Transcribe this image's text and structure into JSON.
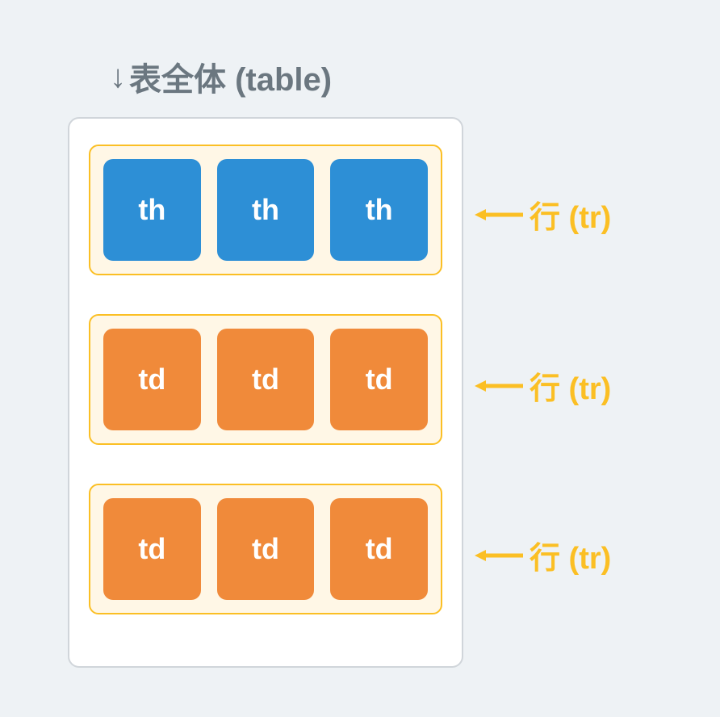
{
  "title": {
    "arrow": "↓",
    "text": "表全体 (table)"
  },
  "rows": [
    {
      "cells": [
        "th",
        "th",
        "th"
      ],
      "type": "header",
      "label": "行 (tr)"
    },
    {
      "cells": [
        "td",
        "td",
        "td"
      ],
      "type": "data",
      "label": "行 (tr)"
    },
    {
      "cells": [
        "td",
        "td",
        "td"
      ],
      "type": "data",
      "label": "行 (tr)"
    }
  ]
}
